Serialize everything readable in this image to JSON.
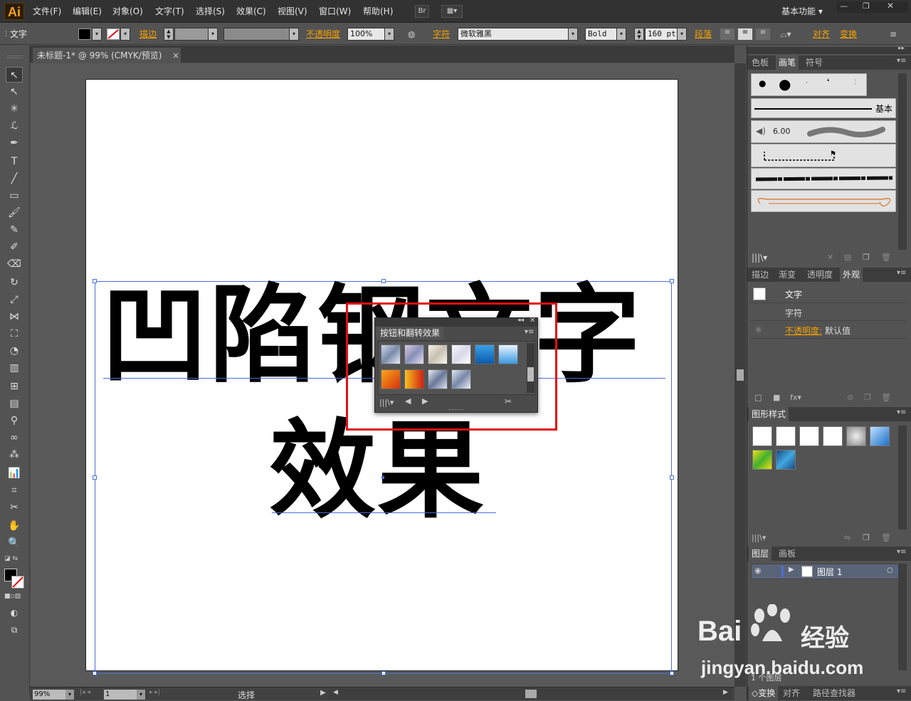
{
  "app": {
    "logo": "Ai",
    "workspace": "基本功能"
  },
  "menu": [
    "文件(F)",
    "编辑(E)",
    "对象(O)",
    "文字(T)",
    "选择(S)",
    "效果(C)",
    "视图(V)",
    "窗口(W)",
    "帮助(H)"
  ],
  "bridge_label": "Br",
  "control": {
    "mode": "文字",
    "stroke_label": "描边",
    "opacity_label": "不透明度",
    "opacity_value": "100%",
    "char_label": "字符",
    "font_family": "微软雅黑",
    "font_style": "Bold",
    "font_size": "160 pt",
    "paragraph_label": "段落",
    "align_label": "对齐",
    "transform_label": "变换"
  },
  "document": {
    "tab_title": "未标题-1* @ 99% (CMYK/预览)"
  },
  "artwork": {
    "line1": "凹陷钢文字",
    "line2": "效果"
  },
  "status": {
    "zoom": "99%",
    "page": "1",
    "tool": "选择"
  },
  "float_panel": {
    "title": "按钮和翻转效果"
  },
  "panels": {
    "swatch_tabs": [
      "色板",
      "画笔",
      "符号"
    ],
    "brush_basic": "基本",
    "brush_size": "6.00",
    "appearance_tabs": [
      "描边",
      "渐变",
      "透明度",
      "外观"
    ],
    "appearance": {
      "object": "文字",
      "character": "字符",
      "opacity_label": "不透明度:",
      "opacity_value": "默认值"
    },
    "graphic_styles_tab": "图形样式",
    "layers_tabs": [
      "图层",
      "画板"
    ],
    "layer_name": "图层 1",
    "layer_count": "1 个图层",
    "bottom_tabs": [
      "变换",
      "对齐",
      "路径查找器"
    ]
  },
  "watermark": {
    "brand": "Bai",
    "brand2": "经验",
    "url": "jingyan.baidu.com"
  },
  "colors": {
    "accent_orange": "#f5a000",
    "selection_blue": "#4a6fd6",
    "highlight_red": "#e21010"
  }
}
